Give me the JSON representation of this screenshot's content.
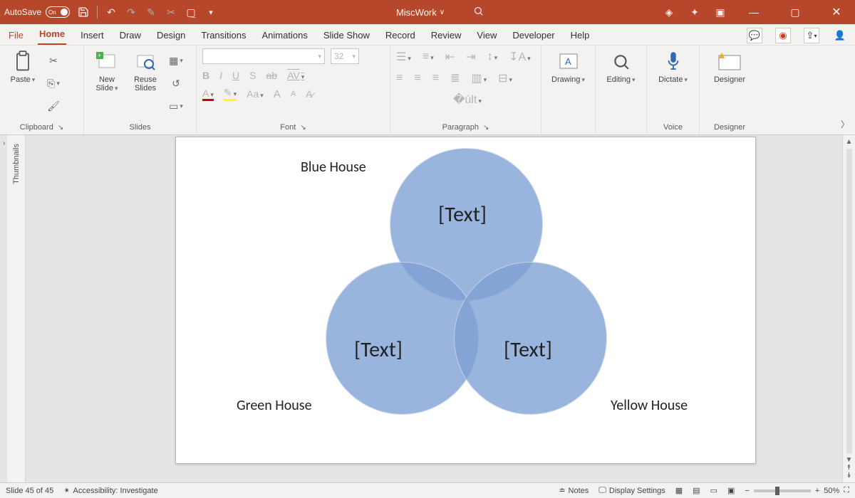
{
  "titlebar": {
    "autosave_label": "AutoSave",
    "autosave_state": "On",
    "doc_name": "MiscWork"
  },
  "tabs": {
    "file": "File",
    "items": [
      "Home",
      "Insert",
      "Draw",
      "Design",
      "Transitions",
      "Animations",
      "Slide Show",
      "Record",
      "Review",
      "View",
      "Developer",
      "Help"
    ],
    "active_index": 0
  },
  "ribbon": {
    "clipboard": {
      "label": "Clipboard",
      "paste": "Paste"
    },
    "slides": {
      "label": "Slides",
      "new_slide": "New\nSlide",
      "reuse": "Reuse\nSlides"
    },
    "font": {
      "label": "Font",
      "size": "32",
      "b": "B",
      "i": "I",
      "u": "U",
      "s": "S",
      "ab": "ab",
      "av": "AV",
      "aa": "Aa",
      "ainc": "A",
      "adec": "A"
    },
    "paragraph": {
      "label": "Paragraph"
    },
    "drawing": {
      "label": "Drawing",
      "btn": "Drawing"
    },
    "editing": {
      "label": "Editing",
      "btn": "Editing"
    },
    "voice": {
      "label": "Voice",
      "btn": "Dictate"
    },
    "designer": {
      "label": "Designer",
      "btn": "Designer"
    }
  },
  "thumbnails_label": "Thumbnails",
  "slide": {
    "labels": {
      "top": "Blue House",
      "left": "Green House",
      "right": "Yellow House"
    },
    "placeholders": {
      "top": "[Text]",
      "left": "[Text]",
      "right": "[Text]"
    }
  },
  "status": {
    "slide_counter": "Slide 45 of 45",
    "accessibility": "Accessibility: Investigate",
    "notes": "Notes",
    "display": "Display Settings",
    "zoom": "50%"
  }
}
